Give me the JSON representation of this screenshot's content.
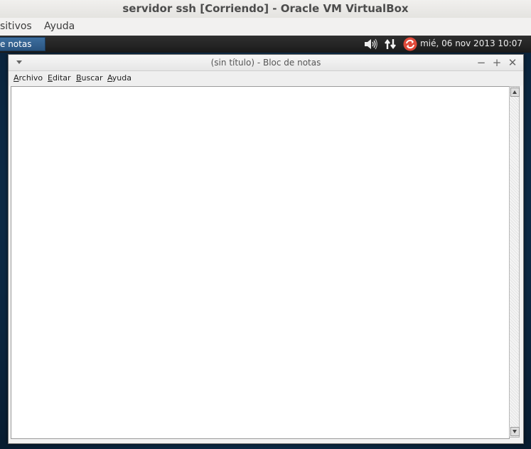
{
  "host": {
    "window_title": "servidor ssh [Corriendo] - Oracle VM VirtualBox",
    "menu": [
      "sitivos",
      "Ayuda"
    ]
  },
  "panel": {
    "task_button_label": "e notas",
    "clock": "mié, 06 nov 2013 10:07",
    "tray_icons": [
      "speaker-icon",
      "network-icon",
      "update-icon"
    ]
  },
  "editor_window": {
    "title": "(sin título) - Bloc de notas",
    "menu": [
      "Archivo",
      "Editar",
      "Buscar",
      "Ayuda"
    ],
    "menu_mnemonics": [
      "A",
      "E",
      "B",
      "A"
    ],
    "text": ""
  }
}
